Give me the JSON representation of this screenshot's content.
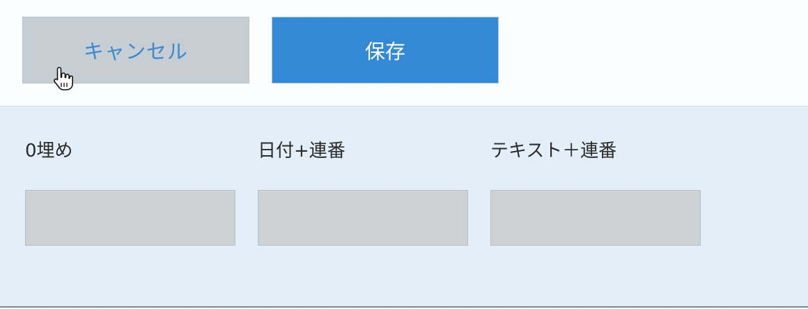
{
  "toolbar": {
    "cancel_label": "キャンセル",
    "save_label": "保存"
  },
  "panel": {
    "fields": [
      {
        "label": "0埋め"
      },
      {
        "label": "日付+連番"
      },
      {
        "label": "テキスト＋連番"
      }
    ]
  },
  "colors": {
    "cancel_bg": "#c6cdd3",
    "cancel_text": "#3a8ad0",
    "save_bg": "#3389d4",
    "panel_bg": "#e2eff8",
    "field_box_bg": "#ced2d5"
  }
}
